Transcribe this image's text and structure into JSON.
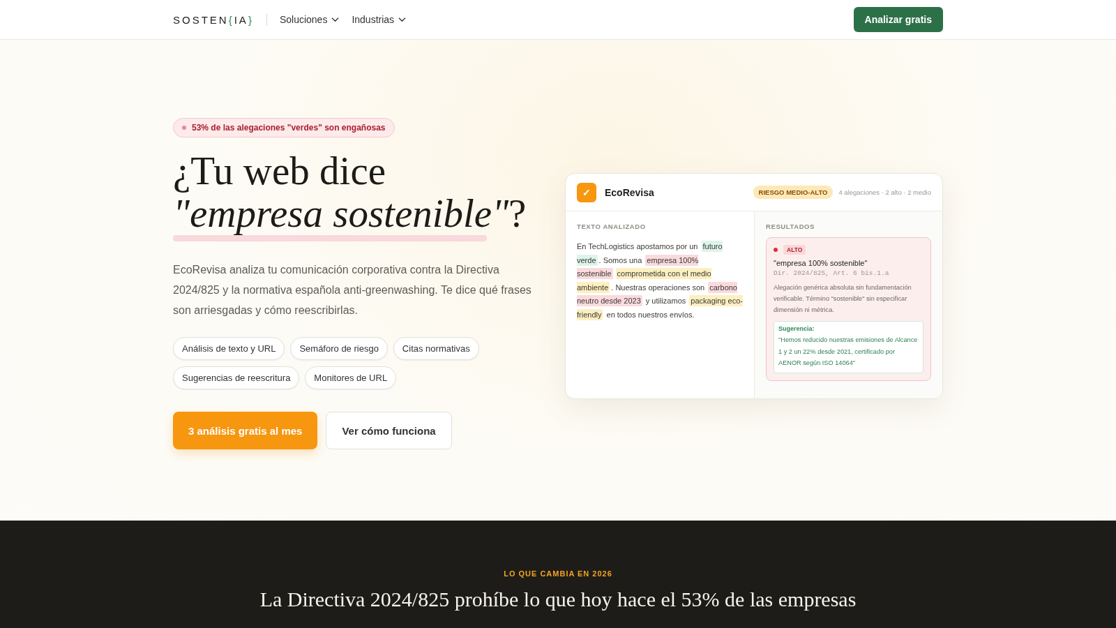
{
  "nav": {
    "logo": {
      "prefix": "SOSTEN",
      "open": "{",
      "middle": "IA",
      "close": "}"
    },
    "menus": [
      {
        "label": "Soluciones"
      },
      {
        "label": "Industrias"
      }
    ],
    "cta": "Analizar gratis"
  },
  "hero": {
    "badge": "53% de las alegaciones \"verdes\" son engañosas",
    "title_line1": "¿Tu web dice",
    "title_line2": "*\"empresa sostenible\"*?",
    "description": "EcoRevisa analiza tu comunicación corporativa contra la Directiva 2024/825 y la normativa española anti-greenwashing. Te dice qué frases son arriesgadas y cómo reescribirlas.",
    "features": [
      [
        "Análisis de texto y URL",
        "Semáforo de riesgo",
        "Citas normativas"
      ],
      [
        "Sugerencias de reescritura",
        "Monitores de URL"
      ]
    ],
    "primary_button": "3 análisis gratis al mes",
    "secondary_button": "Ver cómo funciona"
  },
  "demo": {
    "icon": "✓",
    "app_name": "EcoRevisa",
    "risk_badge": "RIESGO MEDIO-ALTO",
    "summary": "4 alegaciones · 2 alto · 2 medio",
    "text_heading": "TEXTO ANALIZADO",
    "segments": [
      {
        "text": "En TechLogistics apostamos por un ",
        "kind": "plain"
      },
      {
        "text": "futuro verde",
        "kind": "ok"
      },
      {
        "text": ". Somos una ",
        "kind": "plain"
      },
      {
        "text": "empresa 100% sostenible",
        "kind": "high"
      },
      {
        "text": "comprometida con el medio ambiente",
        "kind": "medium"
      },
      {
        "text": ". Nuestras operaciones son ",
        "kind": "plain"
      },
      {
        "text": "carbono neutro desde 2023",
        "kind": "high"
      },
      {
        "text": " y utilizamos ",
        "kind": "plain"
      },
      {
        "text": "packaging eco-friendly",
        "kind": "medium"
      },
      {
        "text": " en todos nuestros envíos.",
        "kind": "plain"
      }
    ],
    "results_heading": "RESULTADOS",
    "result": {
      "level": "ALTO",
      "color": "#dc2f3c",
      "claim": "\"empresa 100% sostenible\"",
      "reference": "Dir. 2024/825, Art. 6 bis.1.a",
      "explanation": "Alegación genérica absoluta sin fundamentación verificable. Término \"sostenible\" sin especificar dimensión ni métrica.",
      "suggestion_label": "Sugerencia:",
      "suggestion": "\"Hemos reducido nuestras emisiones de Alcance 1 y 2 un 22% desde 2021, certificado por AENOR según ISO 14064\""
    }
  },
  "band": {
    "eyebrow": "LO QUE CAMBIA EN 2026",
    "title": "La Directiva 2024/825 prohíbe lo que hoy hace el 53% de las empresas"
  }
}
